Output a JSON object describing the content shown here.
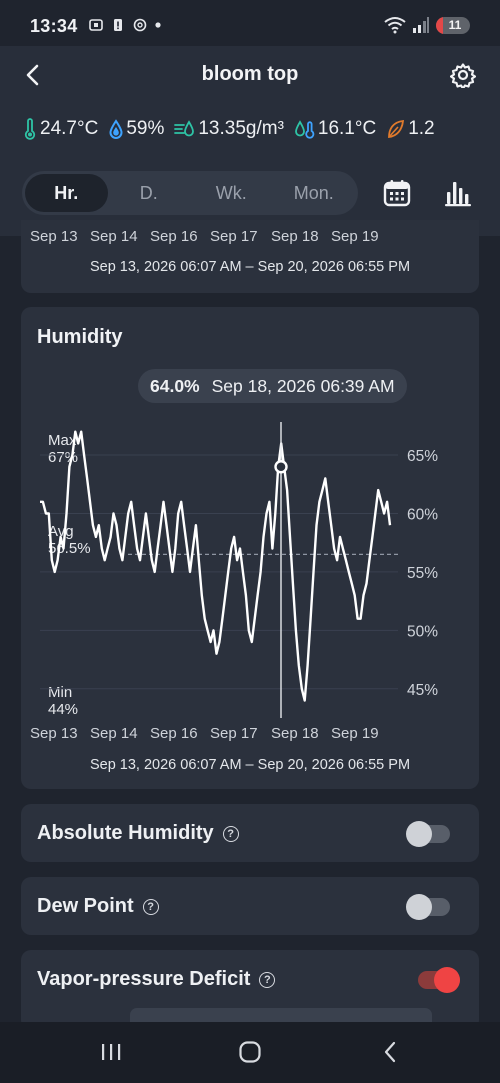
{
  "status": {
    "time": "13:34",
    "battery": "11"
  },
  "header": {
    "title": "bloom top"
  },
  "metrics": {
    "temperature": "24.7°C",
    "humidity": "59%",
    "absolute_humidity": "13.35g/m³",
    "dew_point": "16.1°C",
    "vpd": "1.2"
  },
  "tabs": [
    {
      "label": "Hr.",
      "active": true
    },
    {
      "label": "D.",
      "active": false
    },
    {
      "label": "Wk.",
      "active": false
    },
    {
      "label": "Mon.",
      "active": false
    }
  ],
  "top_card": {
    "ticks": [
      "Sep 13",
      "Sep 14",
      "Sep 16",
      "Sep 17",
      "Sep 18",
      "Sep 19"
    ],
    "range": "Sep 13, 2026 06:07 AM – Sep 20, 2026 06:55 PM"
  },
  "humidity_card": {
    "title": "Humidity",
    "tooltip_value": "64.0%",
    "tooltip_time": "Sep 18, 2026 06:39 AM",
    "max_label": "Max",
    "max_value": "67%",
    "avg_label": "Avg",
    "avg_value": "56.5%",
    "min_label": "Min",
    "min_value": "44%",
    "range": "Sep 13, 2026 06:07 AM – Sep 20, 2026 06:55 PM"
  },
  "chart_data": {
    "type": "line",
    "title": "Humidity",
    "y_ticks": [
      "65%",
      "60%",
      "55%",
      "50%",
      "45%"
    ],
    "x_ticks": [
      "Sep 13",
      "Sep 14",
      "Sep 16",
      "Sep 17",
      "Sep 18",
      "Sep 19"
    ],
    "ylim": [
      42.5,
      68
    ],
    "max": 67,
    "avg": 56.5,
    "min": 44,
    "grid": true,
    "series": [
      {
        "values": [
          61,
          61,
          60,
          60,
          56,
          55,
          56,
          58,
          57,
          60,
          64,
          65,
          67,
          66,
          67,
          65,
          63,
          61,
          59,
          58,
          59,
          57,
          56,
          57,
          58,
          60,
          59,
          57,
          56,
          58,
          60,
          61,
          59,
          57,
          56,
          58,
          60,
          58,
          56,
          55,
          57,
          59,
          61,
          59,
          57,
          55,
          57,
          60,
          61,
          59,
          57,
          55,
          57,
          59,
          56,
          53,
          51,
          50,
          49,
          50,
          48,
          49,
          51,
          53,
          55,
          57,
          58,
          56,
          57,
          55,
          53,
          50,
          49,
          51,
          53,
          55,
          58,
          60,
          61,
          57,
          60,
          64,
          66,
          64,
          62,
          58,
          54,
          50,
          47,
          45,
          44,
          47,
          51,
          55,
          59,
          61,
          62,
          63,
          61,
          59,
          57,
          56,
          58,
          57,
          56,
          55,
          54,
          53,
          51,
          51,
          53,
          54,
          56,
          58,
          60,
          62,
          61,
          60,
          61,
          59
        ]
      }
    ],
    "highlight": {
      "value": 64.0,
      "label": "Sep 18, 2026 06:39 AM"
    }
  },
  "toggles": [
    {
      "label": "Absolute Humidity",
      "on": false
    },
    {
      "label": "Dew Point",
      "on": false
    },
    {
      "label": "Vapor-pressure Deficit",
      "on": true
    }
  ],
  "colors": {
    "temperature_icon": "#2ec4a6",
    "humidity_icon": "#3ea3ff",
    "vpd_icon": "#e07a2c",
    "toggle_on": "#ef4444",
    "line": "#ffffff"
  }
}
